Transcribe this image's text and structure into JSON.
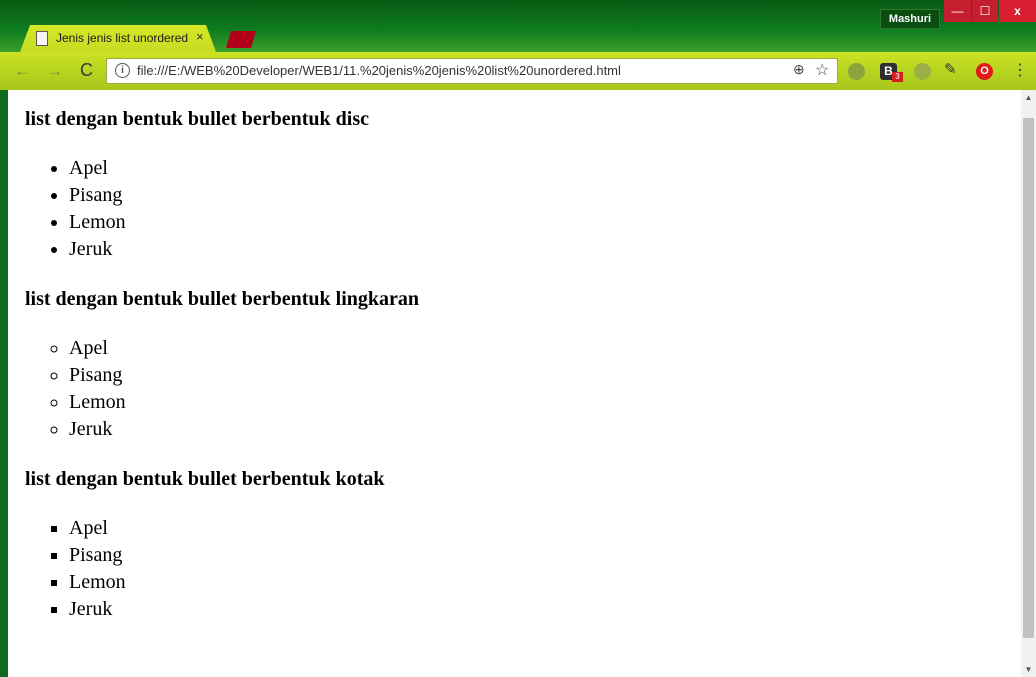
{
  "window": {
    "user_name": "Mashuri",
    "minimize_label": "—",
    "maximize_label": "☐",
    "close_label": "x"
  },
  "tab": {
    "title": "Jenis jenis list unordered",
    "close_label": "×"
  },
  "toolbar": {
    "back_icon": "←",
    "forward_icon": "→",
    "reload_icon": "C",
    "url": "file:///E:/WEB%20Developer/WEB1/11.%20jenis%20jenis%20list%20unordered.html",
    "zoom_icon": "⊕",
    "star_icon": "☆",
    "ext_badge": "B",
    "ext_badge_count": "3",
    "opera_icon": "O",
    "menu_icon": "⋮"
  },
  "page": {
    "sections": [
      {
        "heading": "list dengan bentuk bullet berbentuk disc",
        "items": [
          "Apel",
          "Pisang",
          "Lemon",
          "Jeruk"
        ]
      },
      {
        "heading": "list dengan bentuk bullet berbentuk lingkaran",
        "items": [
          "Apel",
          "Pisang",
          "Lemon",
          "Jeruk"
        ]
      },
      {
        "heading": "list dengan bentuk bullet berbentuk kotak",
        "items": [
          "Apel",
          "Pisang",
          "Lemon",
          "Jeruk"
        ]
      }
    ]
  },
  "colors": {
    "frame": "#0e6b1d",
    "tab_active": "#d6e826",
    "close_button": "#d81e30"
  }
}
